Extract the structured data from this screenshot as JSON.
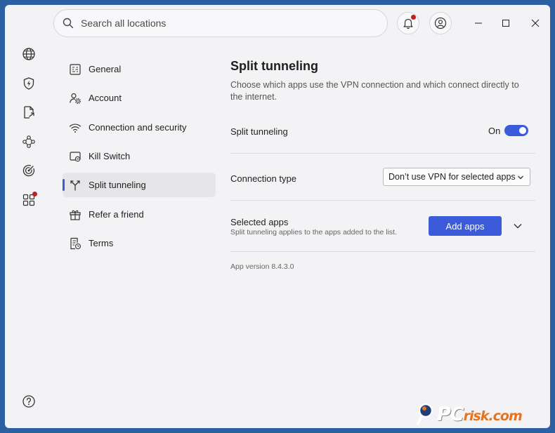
{
  "search": {
    "placeholder": "Search all locations"
  },
  "topbar": {
    "notification_icon": "bell-icon",
    "account_icon": "user-circle-icon"
  },
  "window_controls": [
    "minimize",
    "maximize",
    "close"
  ],
  "rail": {
    "items": [
      "globe-icon",
      "shield-bolt-icon",
      "file-share-icon",
      "mesh-network-icon",
      "radar-icon",
      "apps-grid-icon"
    ],
    "help_icon": "help-circle-icon"
  },
  "nav": {
    "items": [
      {
        "label": "General",
        "icon": "list-settings-icon"
      },
      {
        "label": "Account",
        "icon": "user-gear-icon"
      },
      {
        "label": "Connection and security",
        "icon": "wifi-icon"
      },
      {
        "label": "Kill Switch",
        "icon": "kill-switch-icon"
      },
      {
        "label": "Split tunneling",
        "icon": "split-icon",
        "active": true
      },
      {
        "label": "Refer a friend",
        "icon": "gift-icon"
      },
      {
        "label": "Terms",
        "icon": "document-clock-icon"
      }
    ]
  },
  "content": {
    "title": "Split tunneling",
    "description": "Choose which apps use the VPN connection and which connect directly to the internet.",
    "split_tunneling": {
      "label": "Split tunneling",
      "state_text": "On",
      "enabled": true
    },
    "connection_type": {
      "label": "Connection type",
      "selected": "Don’t use VPN for selected apps"
    },
    "selected_apps": {
      "label": "Selected apps",
      "description": "Split tunneling applies to the apps added to the list.",
      "button": "Add apps"
    },
    "version": "App version 8.4.3.0"
  },
  "watermark": {
    "text_main": "PC",
    "text_rest": "risk.com"
  },
  "colors": {
    "accent": "#3b5bdb",
    "badge": "#c0201f",
    "background": "#2d5fa3"
  }
}
